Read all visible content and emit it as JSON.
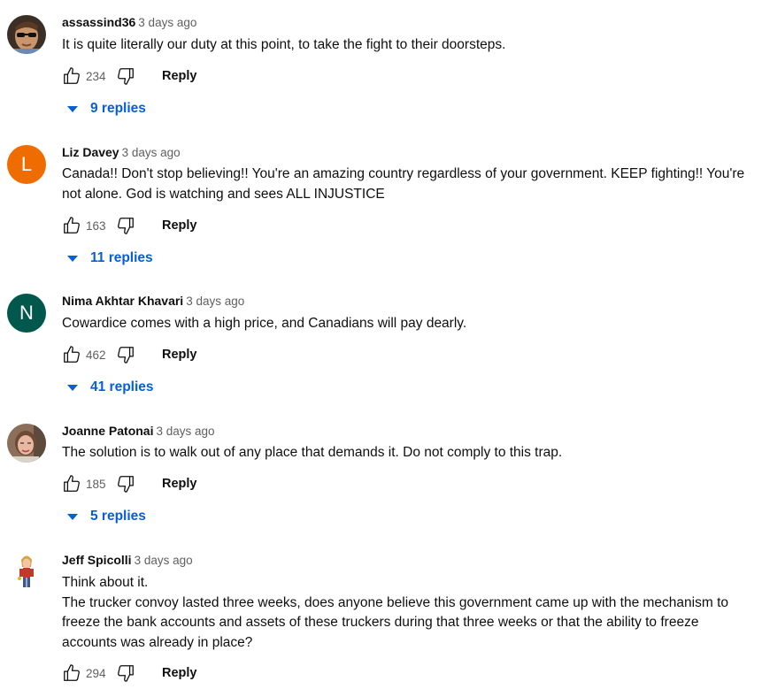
{
  "comments": [
    {
      "author": "assassind36",
      "time": "3 days ago",
      "lines": [
        "It is quite literally our duty at this point, to take the fight to their doorsteps."
      ],
      "likes": "234",
      "reply_label": "Reply",
      "replies": "9 replies",
      "avatar": {
        "type": "photo",
        "icon": "sunglasses-man-avatar"
      }
    },
    {
      "author": "Liz Davey",
      "time": "3 days ago",
      "lines": [
        "Canada!! Don't stop believing!! You're an amazing country regardless of your government. KEEP fighting!! You're",
        "not alone. God is watching and sees ALL INJUSTICE"
      ],
      "likes": "163",
      "reply_label": "Reply",
      "replies": "11 replies",
      "avatar": {
        "type": "letter",
        "letter": "L",
        "color": "#ef6c00"
      }
    },
    {
      "author": "Nima Akhtar Khavari",
      "time": "3 days ago",
      "lines": [
        "Cowardice comes with a high price, and Canadians will pay dearly."
      ],
      "likes": "462",
      "reply_label": "Reply",
      "replies": "41 replies",
      "avatar": {
        "type": "letter",
        "letter": "N",
        "color": "#00574b"
      }
    },
    {
      "author": "Joanne Patonai",
      "time": "3 days ago",
      "lines": [
        "The solution is to walk out of any place that demands it. Do not comply to this trap."
      ],
      "likes": "185",
      "reply_label": "Reply",
      "replies": "5 replies",
      "avatar": {
        "type": "photo",
        "icon": "woman-portrait-avatar"
      }
    },
    {
      "author": "Jeff Spicolli",
      "time": "3 days ago",
      "lines": [
        "Think about it.",
        "The trucker convoy lasted three weeks, does anyone believe this government came up with the mechanism to",
        "freeze the bank accounts and assets of these truckers during that three weeks or that the ability to freeze",
        "accounts was already in place?"
      ],
      "likes": "294",
      "reply_label": "Reply",
      "avatar": {
        "type": "photo",
        "icon": "cartoon-figure-avatar"
      }
    }
  ],
  "colors": {
    "link": "#065fd4",
    "secondary_text": "#606060"
  },
  "icons": {
    "like": "thumb-up-icon",
    "dislike": "thumb-down-icon",
    "expand": "caret-down-icon"
  }
}
